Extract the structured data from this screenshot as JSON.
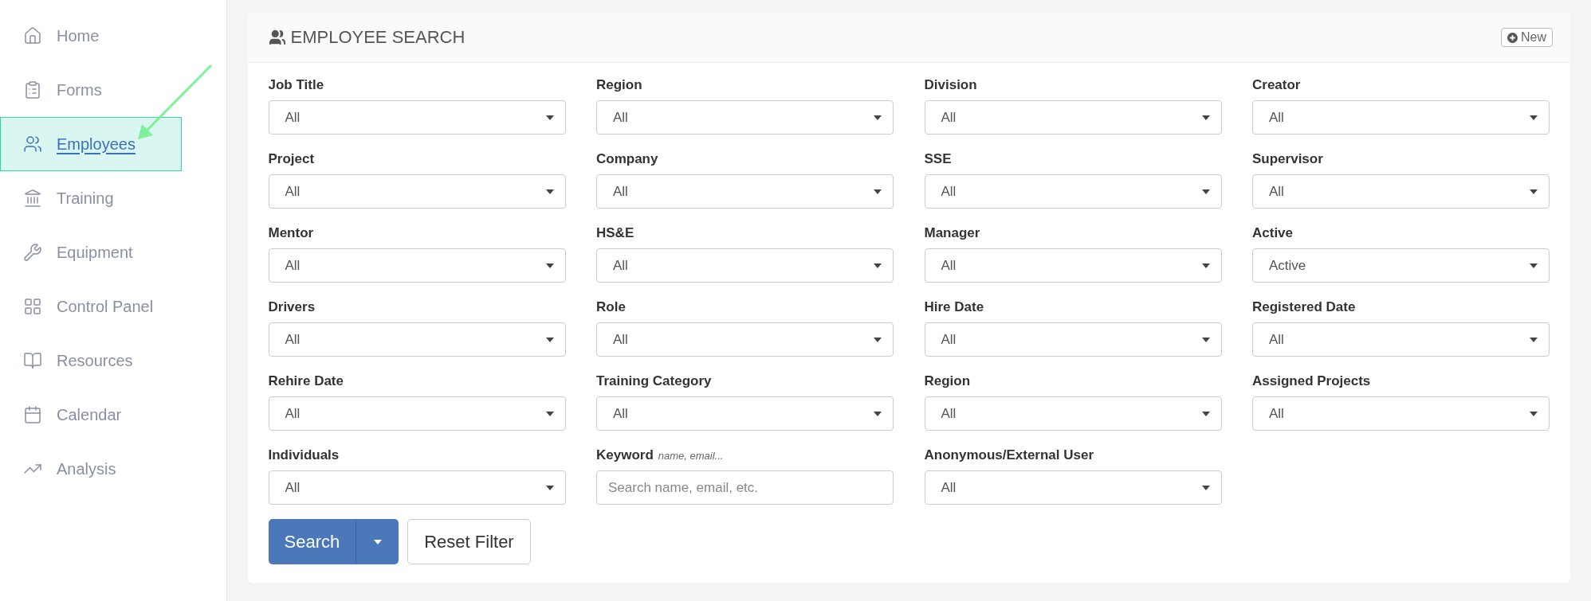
{
  "sidebar": {
    "items": [
      {
        "label": "Home",
        "selected": false
      },
      {
        "label": "Forms",
        "selected": false
      },
      {
        "label": "Employees",
        "selected": true
      },
      {
        "label": "Training",
        "selected": false
      },
      {
        "label": "Equipment",
        "selected": false
      },
      {
        "label": "Control Panel",
        "selected": false
      },
      {
        "label": "Resources",
        "selected": false
      },
      {
        "label": "Calendar",
        "selected": false
      },
      {
        "label": "Analysis",
        "selected": false
      }
    ]
  },
  "panel": {
    "title": "EMPLOYEE SEARCH",
    "new_button": "New",
    "fields": [
      {
        "kind": "select",
        "label": "Job Title",
        "value": "All"
      },
      {
        "kind": "select",
        "label": "Region",
        "value": "All"
      },
      {
        "kind": "select",
        "label": "Division",
        "value": "All"
      },
      {
        "kind": "select",
        "label": "Creator",
        "value": "All"
      },
      {
        "kind": "select",
        "label": "Project",
        "value": "All"
      },
      {
        "kind": "select",
        "label": "Company",
        "value": "All"
      },
      {
        "kind": "select",
        "label": "SSE",
        "value": "All"
      },
      {
        "kind": "select",
        "label": "Supervisor",
        "value": "All"
      },
      {
        "kind": "select",
        "label": "Mentor",
        "value": "All"
      },
      {
        "kind": "select",
        "label": "HS&E",
        "value": "All"
      },
      {
        "kind": "select",
        "label": "Manager",
        "value": "All"
      },
      {
        "kind": "select",
        "label": "Active",
        "value": "Active"
      },
      {
        "kind": "select",
        "label": "Drivers",
        "value": "All"
      },
      {
        "kind": "select",
        "label": "Role",
        "value": "All"
      },
      {
        "kind": "select",
        "label": "Hire Date",
        "value": "All"
      },
      {
        "kind": "select",
        "label": "Registered Date",
        "value": "All"
      },
      {
        "kind": "select",
        "label": "Rehire Date",
        "value": "All"
      },
      {
        "kind": "select",
        "label": "Training Category",
        "value": "All"
      },
      {
        "kind": "select",
        "label": "Region",
        "value": "All"
      },
      {
        "kind": "select",
        "label": "Assigned Projects",
        "value": "All"
      },
      {
        "kind": "select",
        "label": "Individuals",
        "value": "All"
      },
      {
        "kind": "text",
        "label": "Keyword",
        "hint": "name, email...",
        "placeholder": "Search name, email, etc."
      },
      {
        "kind": "select",
        "label": "Anonymous/External User",
        "value": "All"
      }
    ],
    "search_button": "Search",
    "reset_button": "Reset Filter"
  }
}
